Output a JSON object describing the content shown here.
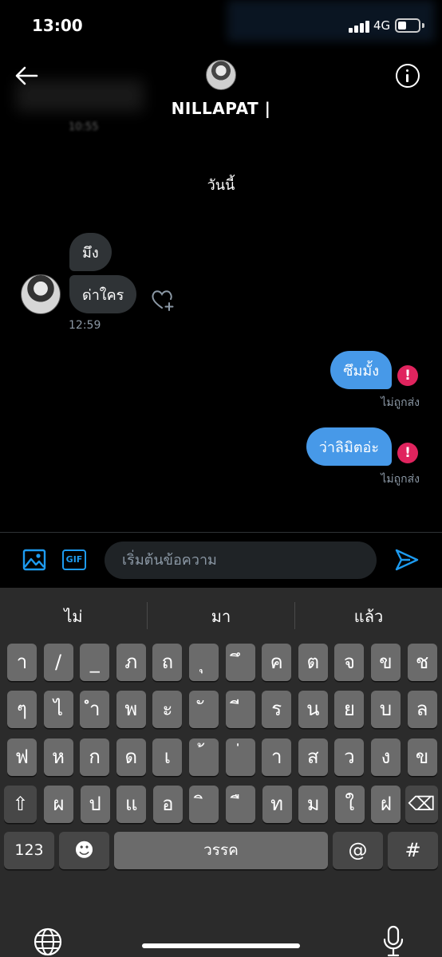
{
  "status_bar": {
    "time": "13:00",
    "network": "4G"
  },
  "header": {
    "contact_name": "NILLAPAT |",
    "previous_time_partial": "10:55"
  },
  "chat": {
    "date_separator": "วันนี้",
    "incoming": [
      {
        "text": "มึง"
      },
      {
        "text": "ด่าใคร"
      }
    ],
    "incoming_time": "12:59",
    "outgoing": [
      {
        "text": "ซึมมั้ง",
        "status": "ไม่ถูกส่ง"
      },
      {
        "text": "ว่าลิมิตอ่ะ",
        "status": "ไม่ถูกส่ง"
      }
    ],
    "error_glyph": "!"
  },
  "composer": {
    "placeholder": "เริ่มต้นข้อความ",
    "gif_label": "GIF"
  },
  "keyboard": {
    "suggestions": [
      "ไม่",
      "มา",
      "แล้ว"
    ],
    "row1": [
      "า",
      "/",
      "_",
      "ภ",
      "ถ",
      "ุ",
      "ึ",
      "ค",
      "ต",
      "จ",
      "ข",
      "ช"
    ],
    "row2": [
      "ๆ",
      "ไ",
      "ำ",
      "พ",
      "ะ",
      "ั",
      "ี",
      "ร",
      "น",
      "ย",
      "บ",
      "ล"
    ],
    "row3": [
      "ฟ",
      "ห",
      "ก",
      "ด",
      "เ",
      "้",
      "่",
      "า",
      "ส",
      "ว",
      "ง",
      "ข"
    ],
    "row4": [
      "ผ",
      "ป",
      "แ",
      "อ",
      "ิ",
      "ื",
      "ท",
      "ม",
      "ใ",
      "ฝ"
    ],
    "shift_glyph": "⇧",
    "backspace_glyph": "⌫",
    "numbers_label": "123",
    "emoji_glyph": "☻",
    "space_label": "วรรค",
    "at_label": "@",
    "hash_label": "#"
  },
  "colors": {
    "accent": "#1d9bf0",
    "outgoing_bubble": "#4799e8",
    "incoming_bubble": "#2f3336",
    "error": "#e0245e"
  },
  "icons": [
    "back-arrow-icon",
    "info-icon",
    "heart-add-icon",
    "image-icon",
    "gif-icon",
    "send-icon",
    "globe-icon",
    "microphone-icon"
  ]
}
